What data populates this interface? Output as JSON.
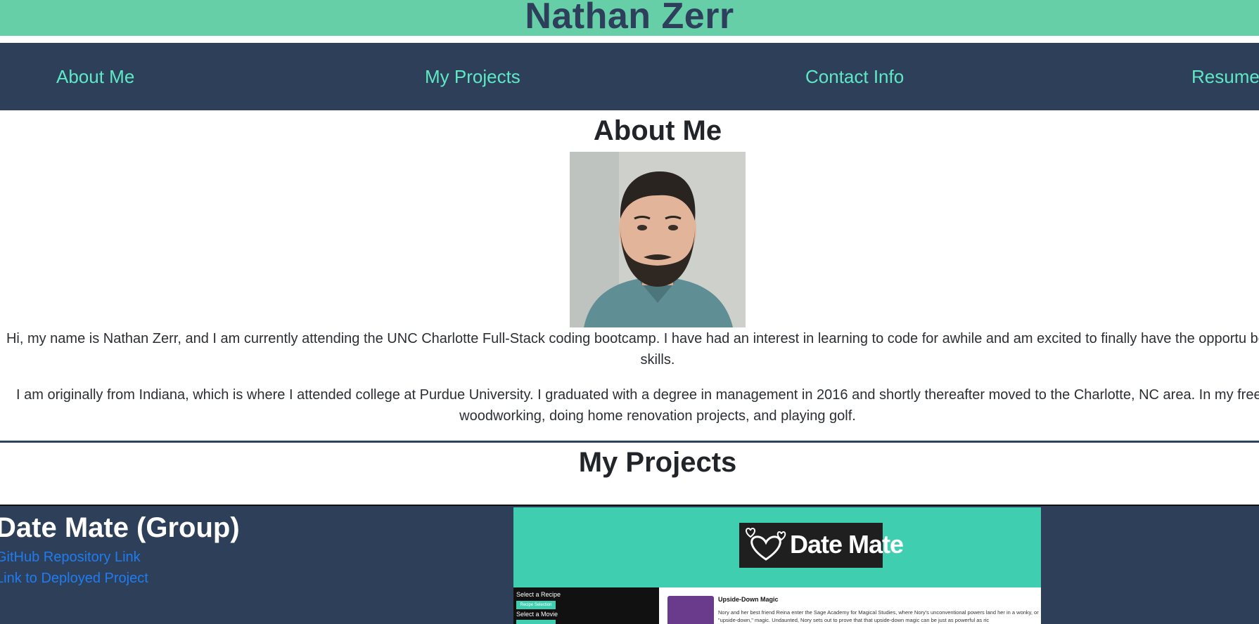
{
  "header": {
    "title": "Nathan Zerr"
  },
  "nav": {
    "items": [
      {
        "label": "About Me"
      },
      {
        "label": "My Projects"
      },
      {
        "label": "Contact Info"
      },
      {
        "label": "Resume"
      }
    ]
  },
  "about": {
    "heading": "About Me",
    "paragraphs": [
      "Hi, my name is Nathan Zerr, and I am currently attending the UNC Charlotte Full-Stack coding bootcamp. I have had an interest in learning to code for awhile and am excited to finally have the opportu better my skills.",
      "I am originally from Indiana, which is where I attended college at Purdue University. I graduated with a degree in management in 2016 and shortly thereafter moved to the Charlotte, NC area. In my free enjoy woodworking, doing home renovation projects, and playing golf."
    ]
  },
  "projects": {
    "heading": "My Projects",
    "items": [
      {
        "title": "Date Mate (Group)",
        "repo_link": "GitHub Repository Link",
        "deploy_link": "Link to Deployed Project",
        "screenshot": {
          "logo_text": "Date Mate",
          "sidebar_labels": [
            "Select a Recipe",
            "Select a Movie"
          ],
          "sidebar_button": "Recipe Selection",
          "book_title": "Upside-Down Magic",
          "book_desc": "Nory and her best friend Reina enter the Sage Academy for Magical Studies, where Nory's unconventional powers land her in a wonky, or \"upside-down,\" magic. Undaunted, Nory sets out to prove that that upside-down magic can be just as powerful as ric"
        }
      }
    ]
  },
  "colors": {
    "header_bg": "#66cfa8",
    "nav_bg": "#2e4059",
    "nav_link": "#5ee8c6",
    "project_link": "#1f7cf0"
  }
}
